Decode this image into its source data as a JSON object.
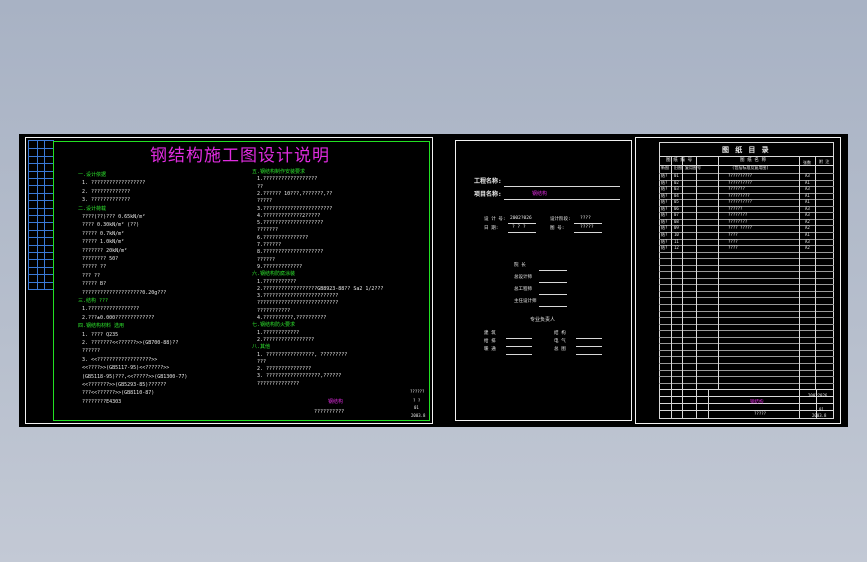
{
  "sheet_a": {
    "title": "钢结构施工图设计说明",
    "left_col": [
      {
        "t": "一.设计依据",
        "c": "g"
      },
      {
        "t": "1. ??????????????????",
        "c": "w"
      },
      {
        "t": "2. ?????????????",
        "c": "w"
      },
      {
        "t": "3. ?????????????",
        "c": "w"
      },
      {
        "t": "二.设计荷载",
        "c": "g"
      },
      {
        "t": "????(??)???         0.65kN/m²",
        "c": "w"
      },
      {
        "t": "????                0.30kN/m² (??)",
        "c": "w"
      },
      {
        "t": "?????               0.7kN/m²",
        "c": "w"
      },
      {
        "t": "?????               1.0kN/m²",
        "c": "w"
      },
      {
        "t": "???????             20kN/m²",
        "c": "w"
      },
      {
        "t": "????????            50?",
        "c": "w"
      },
      {
        "t": "?????                            ??",
        "c": "w"
      },
      {
        "t": "???                              ??",
        "c": "w"
      },
      {
        "t": "?????                            B?",
        "c": "w"
      },
      {
        "t": "????????????????????0.20g???",
        "c": "w"
      },
      {
        "t": "三.结构 ???",
        "c": "g"
      },
      {
        "t": "1.?????????????????",
        "c": "w"
      },
      {
        "t": "2.???±0.000?????????????",
        "c": "w"
      },
      {
        "t": "四.钢结构材料 选用",
        "c": "g"
      },
      {
        "t": "1. ????     Q235",
        "c": "w"
      },
      {
        "t": "2. ???????<<??????>>(GB700-88)??",
        "c": "w"
      },
      {
        "t": "   ??????",
        "c": "w"
      },
      {
        "t": "3. <<??????????????????>>",
        "c": "w"
      },
      {
        "t": "   <<????>>(GB5117-95)<<??????>>",
        "c": "w"
      },
      {
        "t": "   (GB5118-95)???,<<?????>>(GB1300-77)",
        "c": "w"
      },
      {
        "t": "   <<???????>>(GB5293-85)??????",
        "c": "w"
      },
      {
        "t": "   ???<<??????>>(GB8110-87)",
        "c": "w"
      },
      {
        "t": "   ????????E4303",
        "c": "w"
      }
    ],
    "right_col": [
      {
        "t": "五.钢结构制作安装要求",
        "c": "g"
      },
      {
        "t": "1.??????????????????",
        "c": "w"
      },
      {
        "t": "  ??",
        "c": "w"
      },
      {
        "t": "2.?????? 10???,???????,??",
        "c": "w"
      },
      {
        "t": "  ?????",
        "c": "w"
      },
      {
        "t": "3.???????????????????????",
        "c": "w"
      },
      {
        "t": "4.?????????????2?????",
        "c": "w"
      },
      {
        "t": "5.????????????????????",
        "c": "w"
      },
      {
        "t": "  ???????",
        "c": "w"
      },
      {
        "t": "6.???????????????",
        "c": "w"
      },
      {
        "t": "7.??????",
        "c": "w"
      },
      {
        "t": "8.????????????????????",
        "c": "w"
      },
      {
        "t": "  ??????",
        "c": "w"
      },
      {
        "t": "9.?????????????",
        "c": "w"
      },
      {
        "t": "六.钢结构防腐涂装",
        "c": "g"
      },
      {
        "t": "1.???????????",
        "c": "w"
      },
      {
        "t": "2.??????????????????GB8923-88??    Sa2 1/2???",
        "c": "w"
      },
      {
        "t": "3.?????????????????????????",
        "c": "w"
      },
      {
        "t": "  ???????????????????????????",
        "c": "w"
      },
      {
        "t": "  ???????????",
        "c": "w"
      },
      {
        "t": "4.??????????,??????????",
        "c": "w"
      },
      {
        "t": "七.钢结构防火要求",
        "c": "g"
      },
      {
        "t": "1.????????????",
        "c": "w"
      },
      {
        "t": "2.?????????????????",
        "c": "w"
      },
      {
        "t": "八.其他",
        "c": "g"
      },
      {
        "t": "1. ????????????????,     ?????????",
        "c": "w"
      },
      {
        "t": "   ???",
        "c": "w"
      },
      {
        "t": "2. ???????????????",
        "c": "w"
      },
      {
        "t": "3. ??????????????????,??????",
        "c": "w"
      },
      {
        "t": "   ??????????????",
        "c": "w"
      }
    ],
    "stamp": "钢结构",
    "footer_text": "??????????",
    "corner": [
      "??????",
      "? ?",
      "01",
      "2003.8"
    ]
  },
  "sheet_b": {
    "project_label": "工程名称:",
    "item_label": "项目名称:",
    "item_value": "钢结构",
    "row1": [
      "设 计 号:",
      "2002?026",
      "设计阶段:",
      "????"
    ],
    "row2": [
      "日    期:",
      "? ? ?",
      "图    号:",
      "?????"
    ],
    "signs": [
      "院    长",
      "总设计师",
      "总工程师",
      "主任设计师"
    ],
    "group_title": "专业负责人",
    "pairs": [
      [
        "建    筑",
        "结    构"
      ],
      [
        "给    排",
        "电    气"
      ],
      [
        "暖    通",
        "总    图"
      ]
    ]
  },
  "sheet_c": {
    "title": "图 纸 目 录",
    "headers": [
      "图 纸 编 号",
      "图 纸 名 称",
      "张数",
      "附 注"
    ],
    "subheaders": [
      "新图",
      "旧图",
      "复用图号",
      "(包括标准及复用图)"
    ],
    "rows": [
      [
        "结?",
        "01",
        "",
        "??????????",
        "A3"
      ],
      [
        "结?",
        "02",
        "",
        "??????????",
        "A1"
      ],
      [
        "结?",
        "03",
        "",
        "???????",
        "A3"
      ],
      [
        "结?",
        "04",
        "",
        "?????????",
        "A1"
      ],
      [
        "结?",
        "05",
        "",
        "??????????",
        "A1"
      ],
      [
        "结?",
        "06",
        "",
        "??????",
        "A3"
      ],
      [
        "结?",
        "07",
        "",
        "????????",
        "A3"
      ],
      [
        "结?",
        "08",
        "",
        "????????",
        "A2"
      ],
      [
        "结?",
        "09",
        "",
        "????  ?????",
        "A2"
      ],
      [
        "结?",
        "10",
        "",
        "????",
        "A1"
      ],
      [
        "结?",
        "11",
        "",
        "????",
        "A3"
      ],
      [
        "结?",
        "12",
        "",
        "????",
        "A2"
      ]
    ],
    "tb_stamp": "钢结构",
    "tb_code": "2002?026",
    "tb_num": "01",
    "tb_date": "2003.8",
    "tb_name": "?????"
  },
  "colors": {
    "green": "#2ee62e",
    "magenta": "#e02ce0",
    "line": "#d8d8d8"
  }
}
